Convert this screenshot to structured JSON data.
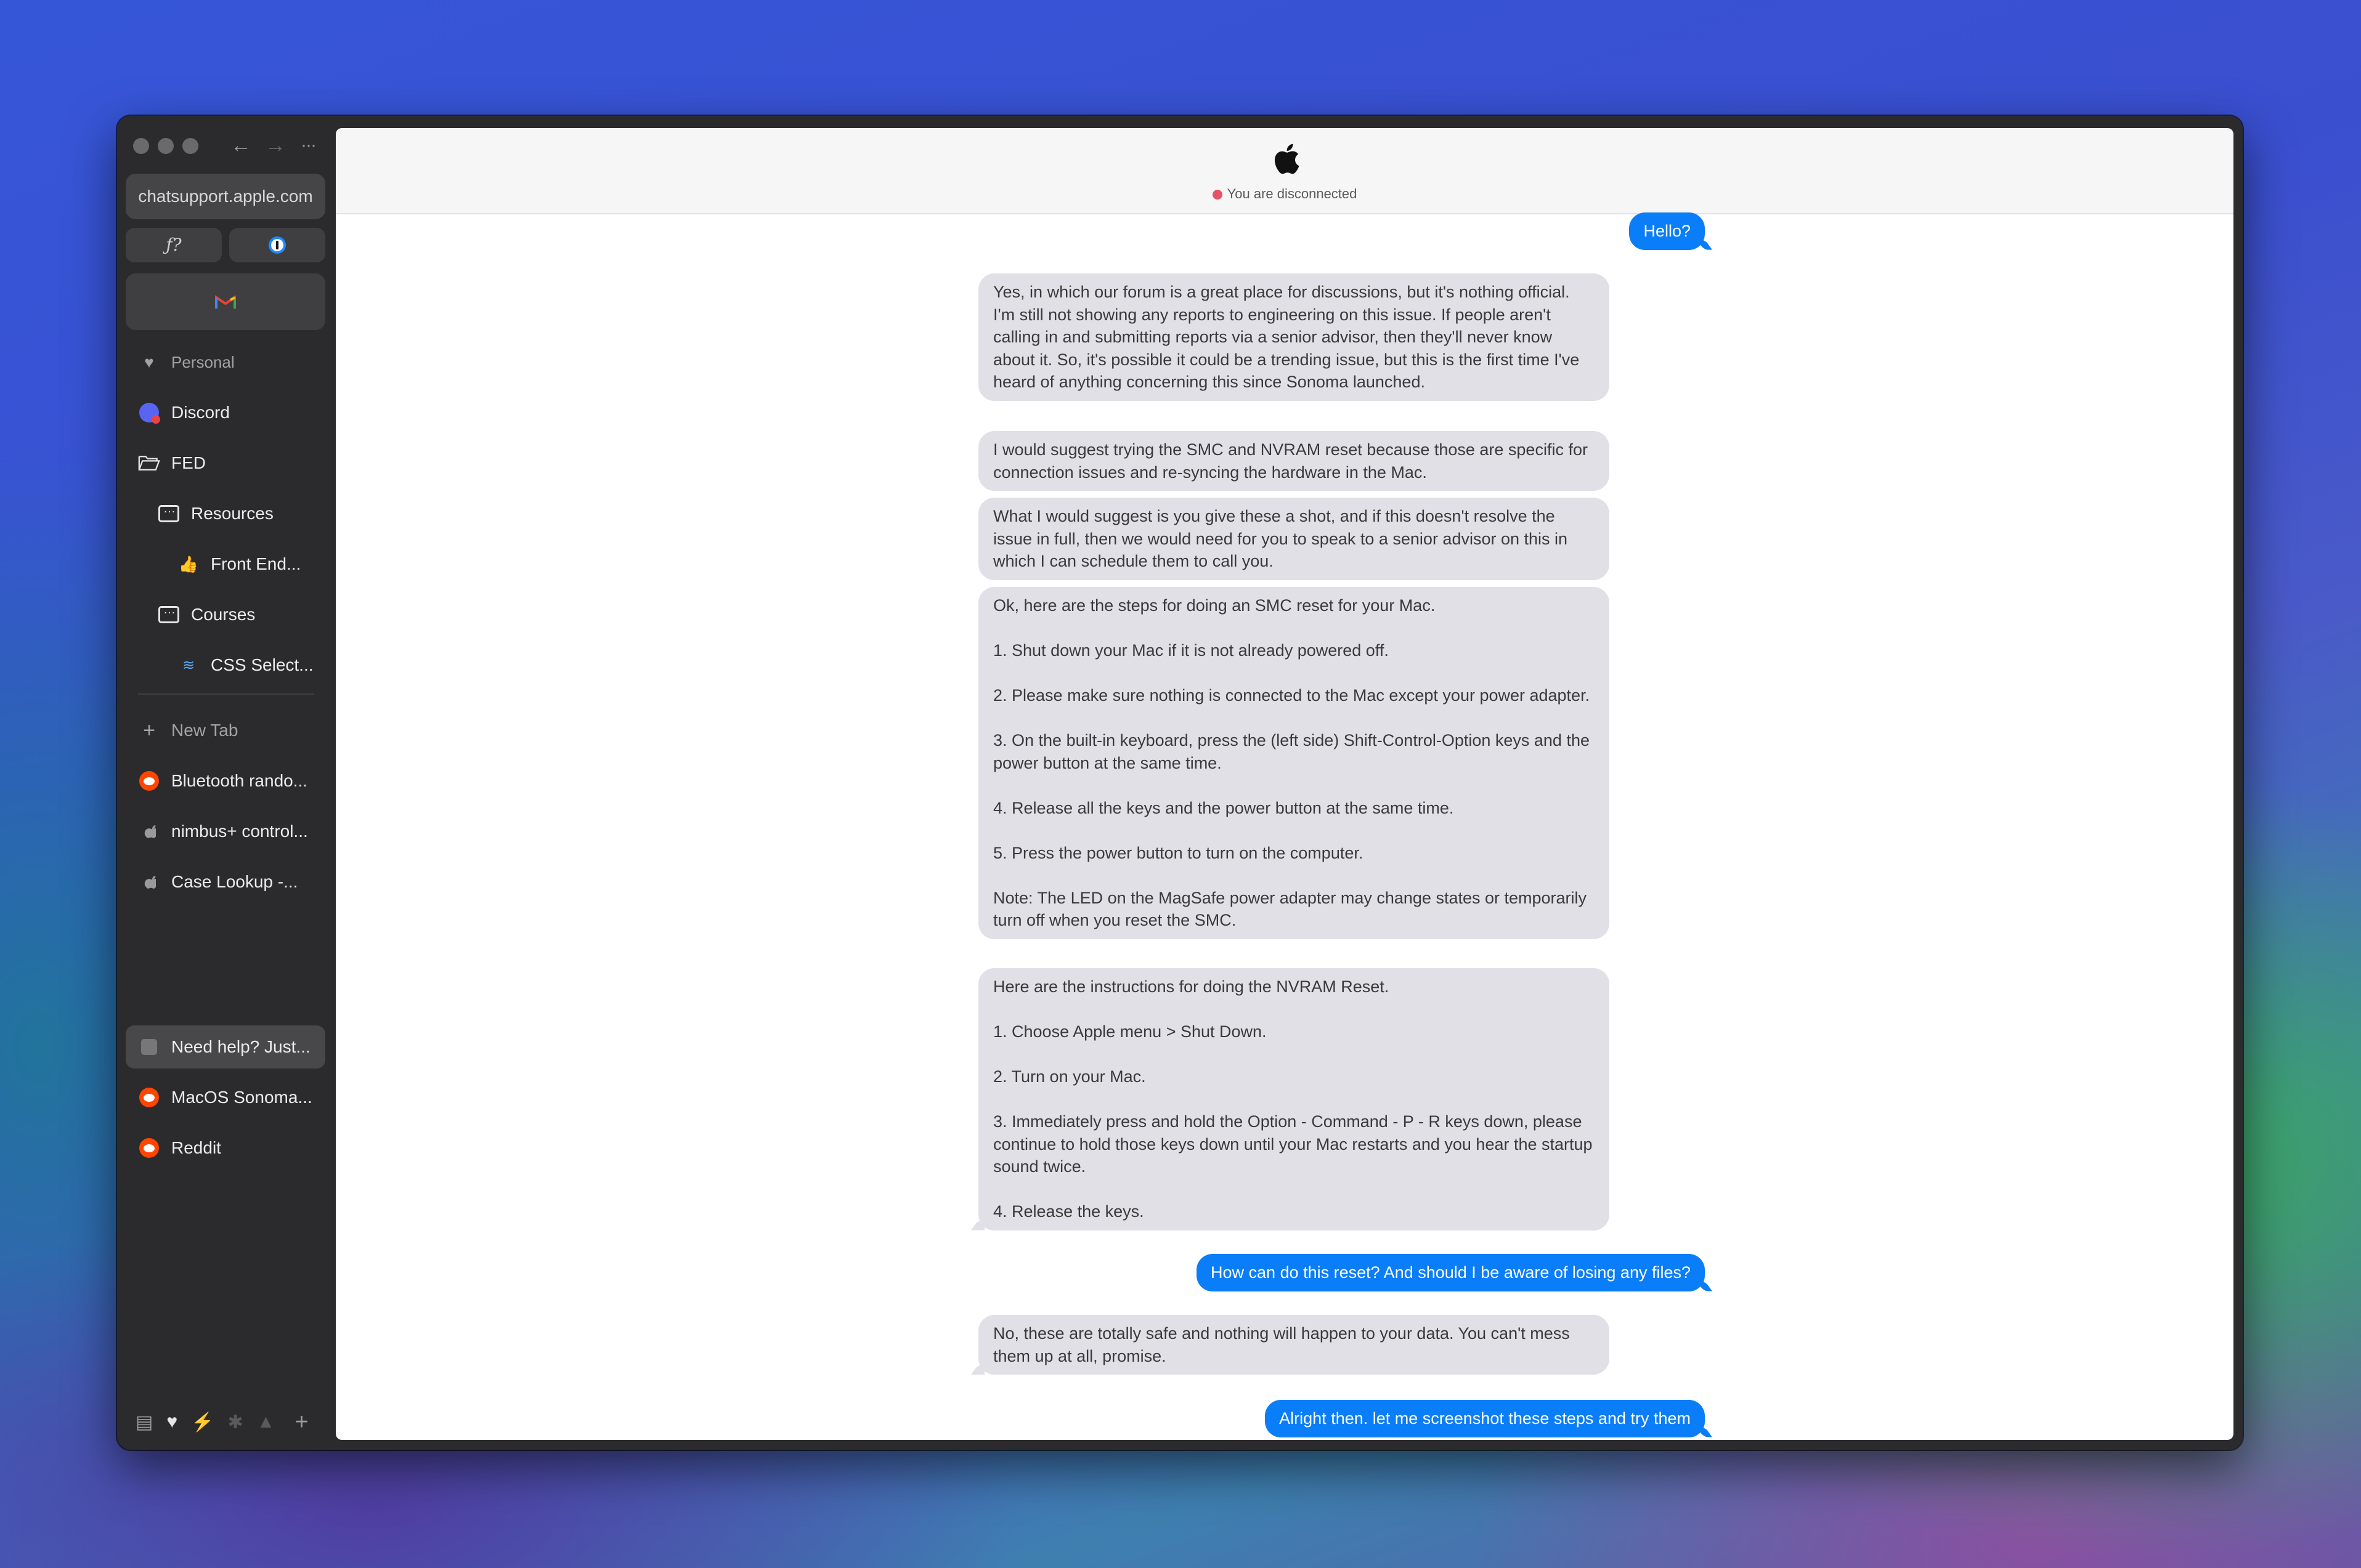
{
  "browser": {
    "url": "chatsupport.apple.com",
    "pinned": [
      {
        "label": "ƒ?",
        "icon": "function-icon"
      },
      {
        "label": "",
        "icon": "1password-icon"
      }
    ],
    "pinned_wide_icon": "gmail-icon",
    "sidebar": {
      "personal_label": "Personal",
      "discord_label": "Discord",
      "fed_label": "FED",
      "resources_label": "Resources",
      "frontend_label": "Front End...",
      "courses_label": "Courses",
      "css_label": "CSS Select...",
      "new_tab_label": "New Tab",
      "tabs": [
        {
          "label": "Bluetooth rando...",
          "icon": "reddit-icon"
        },
        {
          "label": "nimbus+ control...",
          "icon": "apple-icon"
        },
        {
          "label": "Case Lookup -...",
          "icon": "apple-icon"
        },
        {
          "label": "Need help? Just...",
          "icon": "page-icon"
        },
        {
          "label": "MacOS Sonoma...",
          "icon": "reddit-icon"
        },
        {
          "label": "Reddit",
          "icon": "reddit-icon"
        }
      ]
    }
  },
  "chat": {
    "status": "You are disconnected",
    "messages": [
      {
        "from": "user",
        "text": "Hello?"
      },
      {
        "from": "agent",
        "text": "Yes, in which our forum is a great place for discussions, but it's nothing official. I'm still not showing any reports to engineering on this issue. If people aren't calling in and submitting reports via a senior advisor, then they'll never know about it. So, it's possible it could be a trending issue, but this is the first time I've heard of anything concerning this since Sonoma launched."
      },
      {
        "from": "agent",
        "text": "I would suggest trying the SMC and NVRAM reset because those are specific for connection issues and re-syncing the hardware in the Mac."
      },
      {
        "from": "agent",
        "text": "What I would suggest is you give these a shot, and if this doesn't resolve the issue in full, then we would need for you to speak to a senior advisor on this in which I can schedule them to call you."
      },
      {
        "from": "agent",
        "text": "Ok, here are the steps for doing an SMC reset for your Mac.\n\n1. Shut down your Mac if it is not already powered off.\n\n2. Please make sure nothing is connected to the Mac except your power adapter.\n\n3. On the built-in keyboard, press the (left side) Shift-Control-Option keys and the power button at the same time.\n\n4. Release all the keys and the power button at the same time.\n\n5. Press the power button to turn on the computer.\n\nNote: The LED on the MagSafe power adapter may change states or temporarily turn off when you reset the SMC."
      },
      {
        "from": "agent",
        "text": "Here are the instructions for doing the NVRAM Reset.\n\n1. Choose Apple menu > Shut Down.\n\n2. Turn on your Mac.\n\n3. Immediately press and hold the Option - Command - P - R keys down, please continue to hold those keys down until your Mac restarts and you hear the startup sound twice.\n\n4. Release the keys."
      },
      {
        "from": "user",
        "text": "How can do this reset? And should I be aware of losing any files?"
      },
      {
        "from": "agent",
        "text": "No, these are totally safe and nothing will happen to your data. You can't mess them up at all, promise."
      },
      {
        "from": "user",
        "text": "Alright then. let me screenshot these steps and try them"
      }
    ]
  },
  "colors": {
    "user_bubble": "#0a7df8",
    "agent_bubble": "#e0e0e6",
    "status_dot": "#e8516a",
    "sidebar_bg": "#2b2b2d"
  }
}
